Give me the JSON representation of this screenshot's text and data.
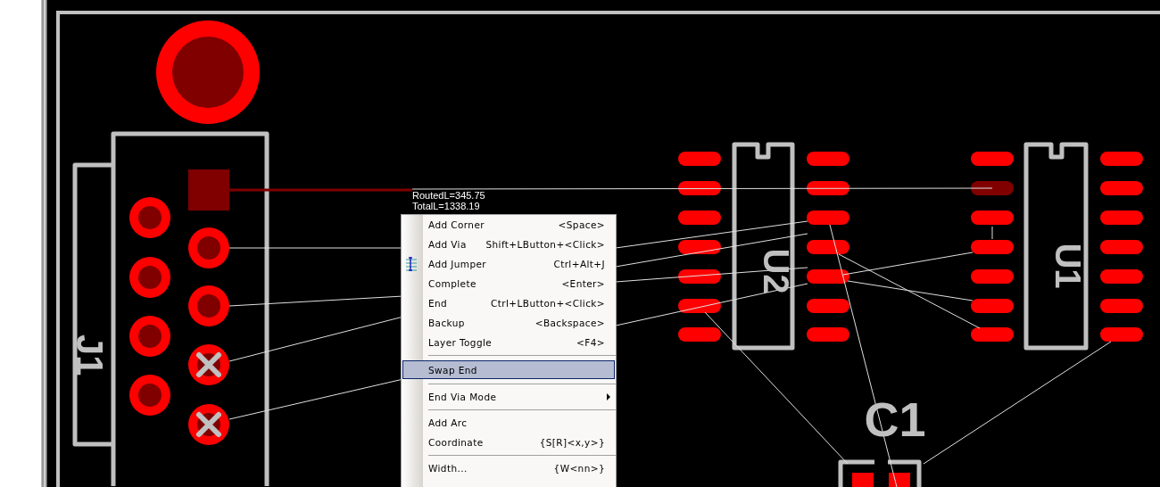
{
  "canvas": {
    "readout": [
      "RoutedL=345.75",
      "TotalL=1338.19"
    ],
    "designators": [
      {
        "text": "J1"
      },
      {
        "text": "U2"
      },
      {
        "text": "U1"
      },
      {
        "text": "C1"
      }
    ]
  },
  "context_menu": {
    "items": [
      {
        "kind": "item",
        "label": "Add Corner",
        "shortcut": "<Space>",
        "selected": false,
        "icon": false,
        "submenu": false
      },
      {
        "kind": "item",
        "label": "Add Via",
        "shortcut": "Shift+LButton+<Click>",
        "selected": false,
        "icon": false,
        "submenu": false
      },
      {
        "kind": "item",
        "label": "Add Jumper",
        "shortcut": "Ctrl+Alt+J",
        "selected": false,
        "icon": true,
        "submenu": false
      },
      {
        "kind": "item",
        "label": "Complete",
        "shortcut": "<Enter>",
        "selected": false,
        "icon": false,
        "submenu": false
      },
      {
        "kind": "item",
        "label": "End",
        "shortcut": "Ctrl+LButton+<Click>",
        "selected": false,
        "icon": false,
        "submenu": false
      },
      {
        "kind": "item",
        "label": "Backup",
        "shortcut": "<Backspace>",
        "selected": false,
        "icon": false,
        "submenu": false
      },
      {
        "kind": "item",
        "label": "Layer Toggle",
        "shortcut": "<F4>",
        "selected": false,
        "icon": false,
        "submenu": false
      },
      {
        "kind": "separator"
      },
      {
        "kind": "item",
        "label": "Swap End",
        "selected": true,
        "icon": false,
        "submenu": false
      },
      {
        "kind": "separator"
      },
      {
        "kind": "item",
        "label": "End Via Mode",
        "selected": false,
        "icon": false,
        "submenu": true
      },
      {
        "kind": "separator"
      },
      {
        "kind": "item",
        "label": "Add Arc",
        "selected": false,
        "icon": false,
        "submenu": false
      },
      {
        "kind": "item",
        "label": "Coordinate",
        "shortcut": "{S[R]<x,y>}",
        "selected": false,
        "icon": false,
        "submenu": false
      },
      {
        "kind": "separator"
      },
      {
        "kind": "item",
        "label": "Width...",
        "shortcut": "{W<nn>}",
        "selected": false,
        "icon": false,
        "submenu": false
      }
    ]
  }
}
